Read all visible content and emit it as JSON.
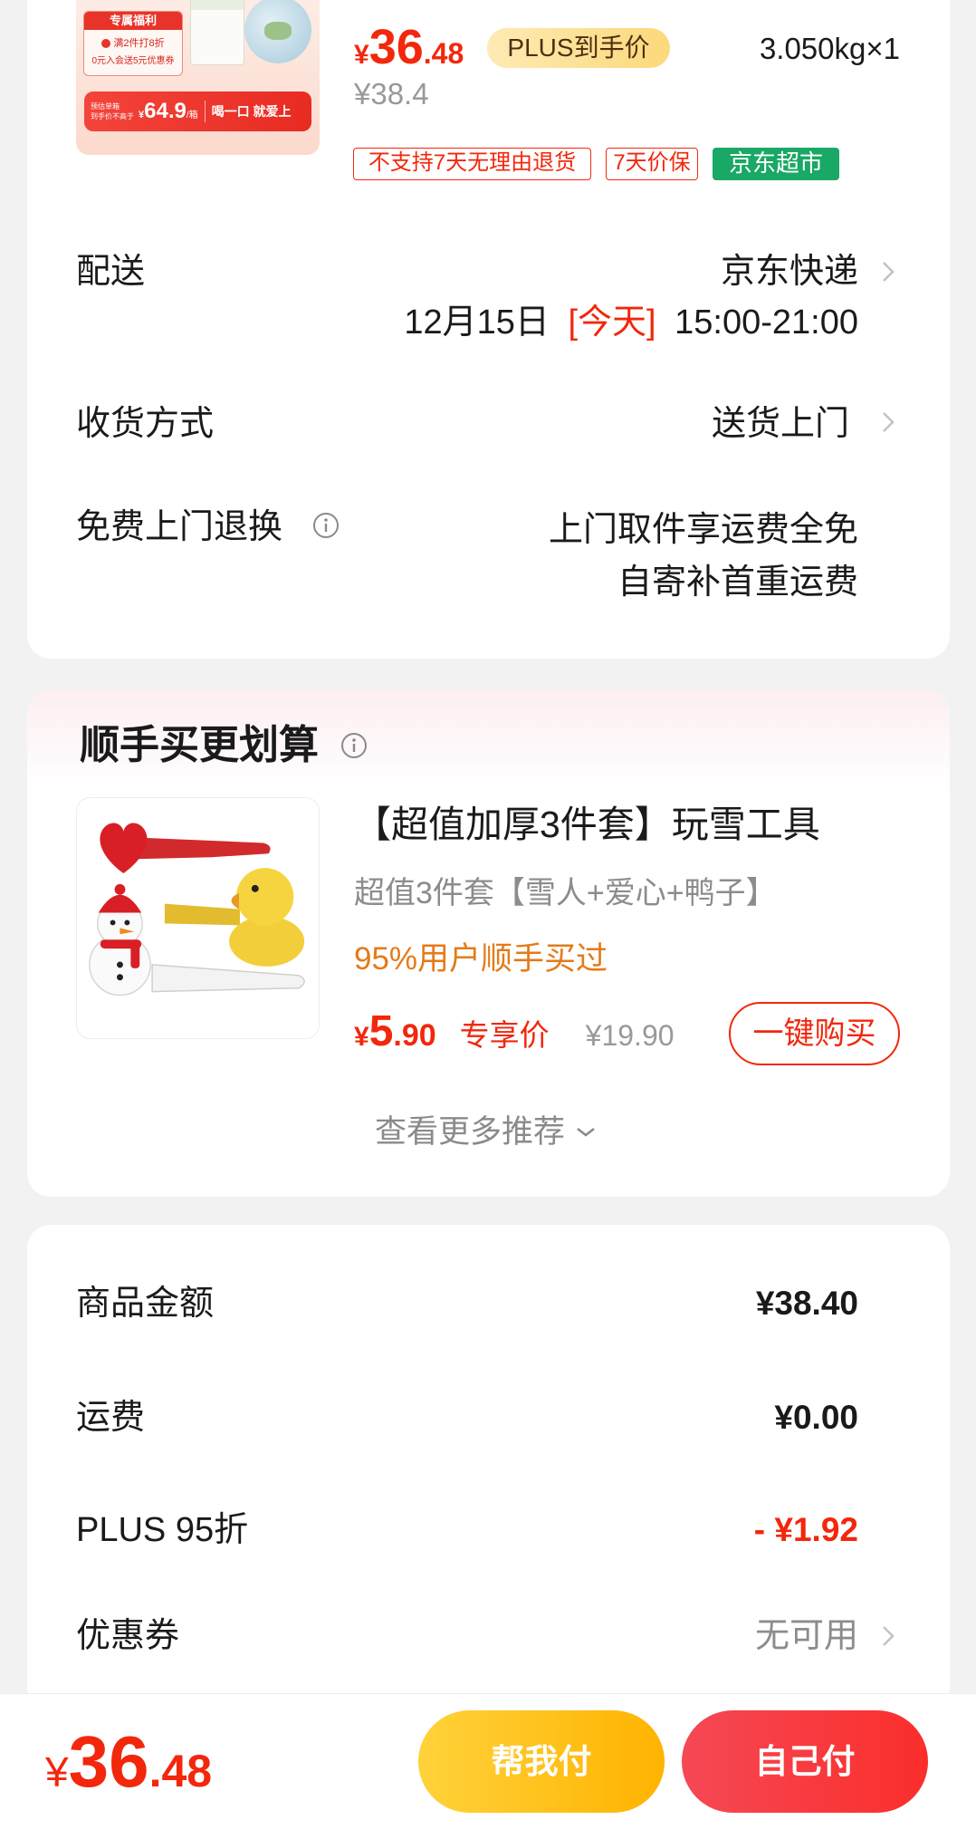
{
  "top_item": {
    "image": {
      "badge": "专属福利",
      "promo_line1": "满2件打8折",
      "promo_line2": "0元入会送5元优惠券",
      "est_line1": "预估单箱",
      "est_line2": "到手价不高于",
      "est_price_symbol": "¥",
      "est_price": "64.9",
      "est_unit": "/箱",
      "slogan": "喝一口 就爱上"
    },
    "price": {
      "symbol": "¥",
      "integer": "36",
      "decimal": ".48"
    },
    "plus_badge": "PLUS到手价",
    "quantity": "3.050kg×1",
    "original_price": "¥38.4",
    "tags": [
      "不支持7天无理由退货",
      "7天价保",
      "京东超市"
    ]
  },
  "delivery": {
    "label": "配送",
    "carrier": "京东快递",
    "date": "12月15日",
    "day": "[今天]",
    "window": "15:00-21:00"
  },
  "receive_method": {
    "label": "收货方式",
    "value": "送货上门"
  },
  "free_return": {
    "label": "免费上门退换",
    "line1": "上门取件享运费全免",
    "line2": "自寄补首重运费"
  },
  "recommend": {
    "title": "顺手买更划算",
    "product": {
      "title": "【超值加厚3件套】玩雪工具",
      "subtitle": "超值3件套【雪人+爱心+鸭子】",
      "social": "95%用户顺手买过",
      "price": {
        "symbol": "¥",
        "integer": "5",
        "decimal": ".90"
      },
      "price_tag": "专享价",
      "original_price": "¥19.90",
      "buy_button": "一键购买"
    },
    "more": "查看更多推荐"
  },
  "summary": {
    "rows": [
      {
        "label": "商品金额",
        "value": "¥38.40"
      },
      {
        "label": "运费",
        "value": "¥0.00"
      },
      {
        "label": "PLUS 95折",
        "value": "- ¥1.92"
      },
      {
        "label": "优惠券",
        "value": "无可用"
      }
    ]
  },
  "bottom_bar": {
    "price": {
      "symbol": "¥",
      "integer": "36",
      "decimal": ".48"
    },
    "help_pay": "帮我付",
    "self_pay": "自己付"
  },
  "colors": {
    "page_bg": "#f2f2f2",
    "price_red": "#f2270c",
    "tag_green": "#19a866",
    "social_orange": "#e57a18",
    "plus_badge": "#fde39f",
    "help_pay_yellow": "#ffbf1a",
    "self_pay_red": "#f63a44"
  },
  "icons": {
    "row_arrow": "chevron-right-icon",
    "info": "info-icon",
    "more": "chevron-down-icon"
  }
}
